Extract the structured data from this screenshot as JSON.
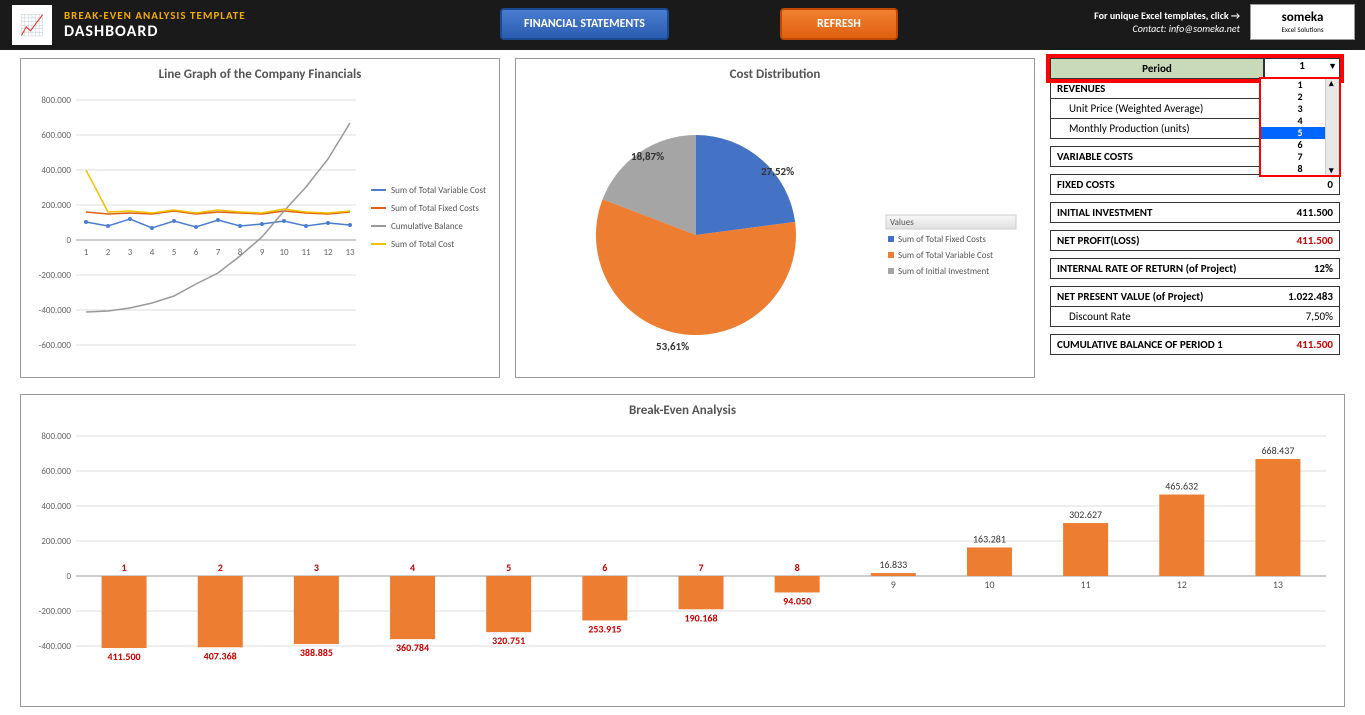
{
  "header": {
    "title1": "BREAK-EVEN ANALYSIS TEMPLATE",
    "title2": "DASHBOARD",
    "fin_btn": "FINANCIAL STATEMENTS",
    "refresh_btn": "REFRESH",
    "click_text": "For unique Excel templates, click →",
    "contact": "Contact: info@someka.net",
    "brand": "someka",
    "brand_sub": "Excel Solutions"
  },
  "line_chart": {
    "title": "Line Graph of the Company Financials"
  },
  "pie_chart": {
    "title": "Cost Distribution"
  },
  "legend": {
    "values": "Values",
    "l1": "Sum of Total Variable Cost",
    "l2": "Sum of Total Fixed Costs",
    "l3": "Cumulative Balance",
    "l4": "Sum of Total Cost",
    "p1": "Sum of Total Fixed Costs",
    "p2": "Sum of Total Variable Cost",
    "p3": "Sum of Initial Investment"
  },
  "metrics": {
    "period_label": "Period",
    "period_value": "1",
    "dropdown": [
      "1",
      "2",
      "3",
      "4",
      "5",
      "6",
      "7",
      "8"
    ],
    "revenues": "REVENUES",
    "unit_price": "Unit Price (Weighted Average)",
    "monthly_prod": "Monthly Production (units)",
    "variable_costs": "VARIABLE COSTS",
    "fixed_costs": "FIXED COSTS",
    "fixed_costs_v": "0",
    "initial_inv": "INITIAL INVESTMENT",
    "initial_inv_v": "411.500",
    "net_profit": "NET PROFIT(LOSS)",
    "net_profit_v": "411.500",
    "irr": "INTERNAL RATE OF RETURN (of Project)",
    "irr_v": "12%",
    "npv": "NET PRESENT VALUE (of Project)",
    "npv_v": "1.022.483",
    "discount": "Discount Rate",
    "discount_v": "7,50%",
    "cumbal": "CUMULATIVE BALANCE OF PERIOD 1",
    "cumbal_v": "411.500"
  },
  "bar_chart": {
    "title": "Break-Even Analysis"
  },
  "chart_data": [
    {
      "type": "line",
      "title": "Line Graph of the Company Financials",
      "x": [
        1,
        2,
        3,
        4,
        5,
        6,
        7,
        8,
        9,
        10,
        11,
        12,
        13
      ],
      "ylim": [
        -600000,
        800000
      ],
      "series": [
        {
          "name": "Sum of Total Variable Cost",
          "color": "#4a7dd0",
          "values": [
            100000,
            80000,
            120000,
            70000,
            110000,
            75000,
            115000,
            80000,
            90000,
            110000,
            80000,
            95000,
            85000
          ]
        },
        {
          "name": "Sum of Total Fixed Costs",
          "color": "#e06010",
          "values": [
            160000,
            150000,
            155000,
            150000,
            165000,
            150000,
            160000,
            155000,
            150000,
            165000,
            155000,
            150000,
            160000
          ]
        },
        {
          "name": "Cumulative Balance",
          "color": "#999",
          "values": [
            -411500,
            -407368,
            -388885,
            -360784,
            -320751,
            -253915,
            -190168,
            -94050,
            16833,
            163281,
            302627,
            465632,
            668437
          ]
        },
        {
          "name": "Sum of Total Cost",
          "color": "#f0c000",
          "values": [
            400000,
            160000,
            165000,
            155000,
            170000,
            155000,
            170000,
            160000,
            155000,
            175000,
            160000,
            155000,
            165000
          ]
        }
      ]
    },
    {
      "type": "pie",
      "title": "Cost Distribution",
      "series": [
        {
          "name": "Sum of Total Fixed Costs",
          "value": 27.52,
          "label": "27,52%",
          "color": "#4472C4"
        },
        {
          "name": "Sum of Total Variable Cost",
          "value": 53.61,
          "label": "53,61%",
          "color": "#ED7D31"
        },
        {
          "name": "Sum of Initial Investment",
          "value": 18.87,
          "label": "18,87%",
          "color": "#A5A5A5"
        }
      ]
    },
    {
      "type": "bar",
      "title": "Break-Even Analysis",
      "categories": [
        1,
        2,
        3,
        4,
        5,
        6,
        7,
        8,
        9,
        10,
        11,
        12,
        13
      ],
      "values": [
        -411500,
        -407368,
        -388885,
        -360784,
        -320751,
        -253915,
        -190168,
        -94050,
        16833,
        163281,
        302627,
        465632,
        668437
      ],
      "value_labels": [
        "411.500",
        "407.368",
        "388.885",
        "360.784",
        "320.751",
        "253.915",
        "190.168",
        "94.050",
        "16.833",
        "163.281",
        "302.627",
        "465.632",
        "668.437"
      ],
      "ylim": [
        -400000,
        800000
      ]
    }
  ]
}
